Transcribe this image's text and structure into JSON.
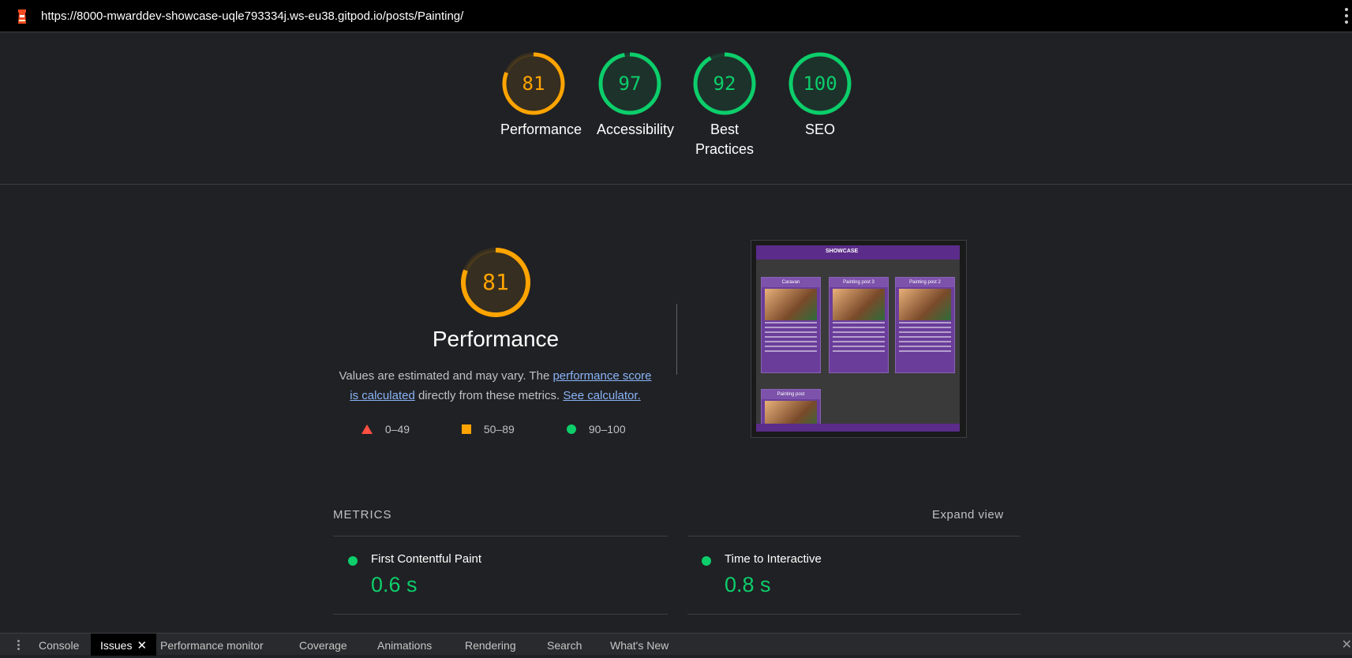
{
  "browser": {
    "url": "https://8000-mwarddev-showcase-uqle793334j.ws-eu38.gitpod.io/posts/Painting/"
  },
  "gauges": [
    {
      "score": "81",
      "label": "Performance",
      "color": "#ffa400",
      "fraction": 0.81
    },
    {
      "score": "97",
      "label": "Accessibility",
      "color": "#0cce6b",
      "fraction": 0.97
    },
    {
      "score": "92",
      "label": "Best Practices",
      "color": "#0cce6b",
      "fraction": 0.92
    },
    {
      "score": "100",
      "label": "SEO",
      "color": "#0cce6b",
      "fraction": 1.0
    }
  ],
  "performance": {
    "score": "81",
    "fraction": 0.81,
    "color": "#ffa400",
    "title": "Performance",
    "description_prefix": "Values are estimated and may vary. The ",
    "score_link": "performance score is calculated",
    "description_middle": " directly from these metrics. ",
    "calculator_link": "See calculator.",
    "legend": [
      {
        "icon": "triangle-icon",
        "range": "0–49",
        "color": "#ff4e42"
      },
      {
        "icon": "square-icon",
        "range": "50–89",
        "color": "#ffa400"
      },
      {
        "icon": "circle-icon",
        "range": "90–100",
        "color": "#0cce6b"
      }
    ]
  },
  "screenshot_thumb": {
    "brand": "SHOWCASE",
    "cards": [
      "Caravan",
      "Painting post 3",
      "Painting post 2",
      "Painting post"
    ]
  },
  "metrics": {
    "heading": "METRICS",
    "expand": "Expand view",
    "items": [
      {
        "name": "First Contentful Paint",
        "value": "0.6 s"
      },
      {
        "name": "Time to Interactive",
        "value": "0.8 s"
      }
    ]
  },
  "drawer": {
    "tabs": [
      "Console",
      "Issues",
      "Performance monitor",
      "Coverage",
      "Animations",
      "Rendering",
      "Search",
      "What's New"
    ],
    "active": "Issues"
  }
}
